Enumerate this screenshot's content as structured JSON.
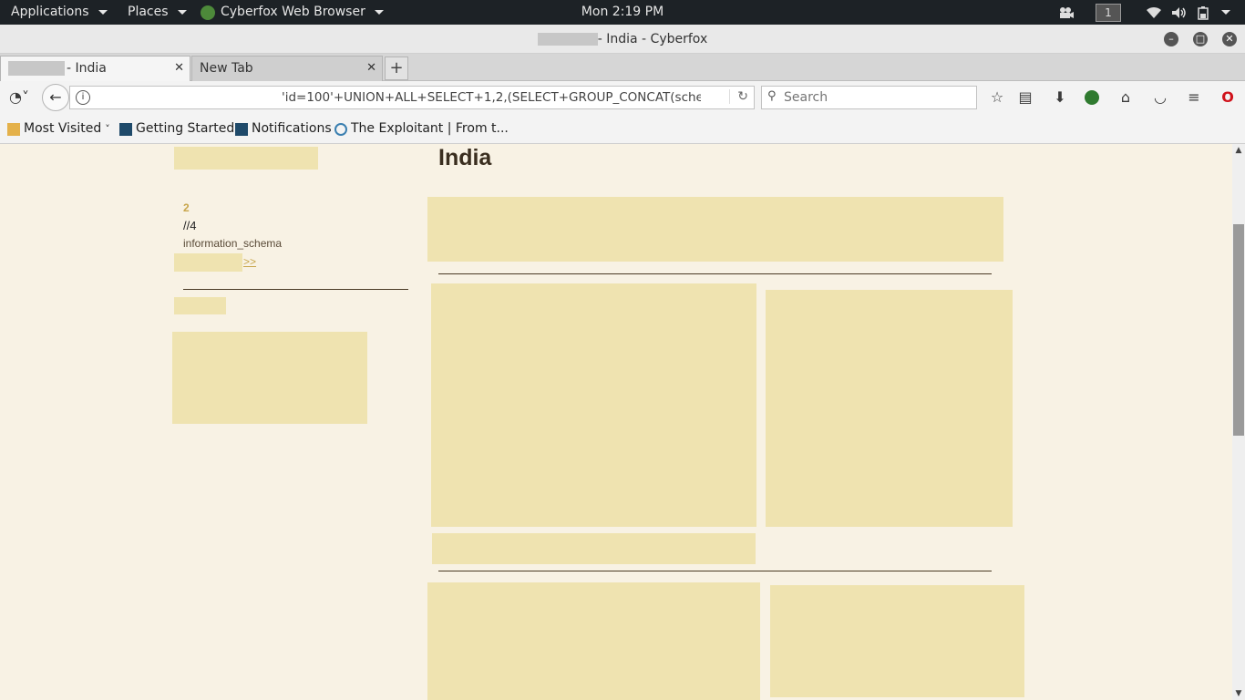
{
  "topbar": {
    "applications": "Applications",
    "places": "Places",
    "browser_menu": "Cyberfox Web Browser",
    "clock": "Mon  2:19 PM",
    "workspace": "1"
  },
  "window": {
    "title": "- India - Cyberfox"
  },
  "tabs": [
    {
      "label": "- India"
    },
    {
      "label": "New Tab"
    }
  ],
  "nav": {
    "url": "'id=100'+UNION+ALL+SELECT+1,2,(SELECT+GROUP_CONCAT(sche",
    "search_placeholder": "Search"
  },
  "bookmarks": [
    {
      "label": "Most Visited"
    },
    {
      "label": "Getting Started"
    },
    {
      "label": "Notifications"
    },
    {
      "label": "The Exploitant | From t..."
    }
  ],
  "page": {
    "title": "India",
    "sidebar": {
      "number": "2",
      "line2": "//4",
      "schema": "information_schema",
      "more_link": ">>"
    }
  },
  "colors": {
    "page_bg": "#f8f2e4",
    "block": "#efe3b0",
    "link": "#c8a64b",
    "rule": "#4a3a24"
  }
}
